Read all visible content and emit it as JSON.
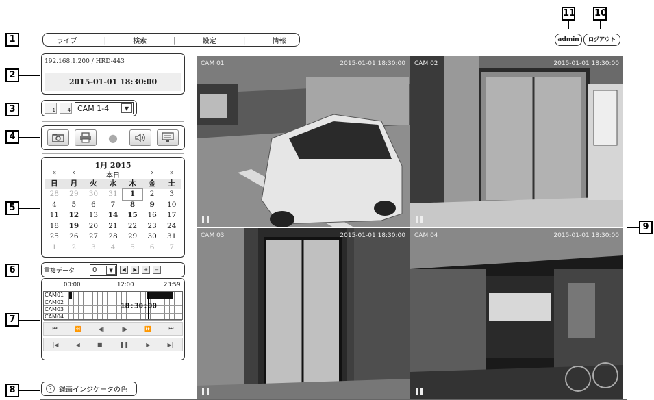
{
  "menu": {
    "items": [
      "ライブ",
      "検索",
      "設定",
      "情報"
    ]
  },
  "header": {
    "user": "admin",
    "logout": "ログアウト"
  },
  "device": {
    "address": "192.168.1.200 / HRD-443",
    "datetime": "2015-01-01 18:30:00"
  },
  "layout_bar": {
    "btn1": "1",
    "btn4": "4",
    "camera_select": "CAM 1-4"
  },
  "toolbar": {
    "icons": [
      "camera-icon",
      "printer-icon",
      "record-dot-icon",
      "speaker-icon",
      "monitor-icon"
    ]
  },
  "calendar": {
    "title": "1月 2015",
    "nav_prev_year": "«",
    "nav_prev_month": "‹",
    "today": "本日",
    "nav_next_month": "›",
    "nav_next_year": "»",
    "weekdays": [
      "日",
      "月",
      "火",
      "水",
      "木",
      "金",
      "土"
    ],
    "weeks": [
      [
        "28",
        "29",
        "30",
        "31",
        "1",
        "2",
        "3"
      ],
      [
        "4",
        "5",
        "6",
        "7",
        "8",
        "9",
        "10"
      ],
      [
        "11",
        "12",
        "13",
        "14",
        "15",
        "16",
        "17"
      ],
      [
        "18",
        "19",
        "20",
        "21",
        "22",
        "23",
        "24"
      ],
      [
        "25",
        "26",
        "27",
        "28",
        "29",
        "30",
        "31"
      ],
      [
        "1",
        "2",
        "3",
        "4",
        "5",
        "6",
        "7"
      ]
    ]
  },
  "duplicate": {
    "label": "重複データ",
    "value": "0",
    "prev": "◀",
    "next": "▶",
    "plus": "+",
    "minus": "−"
  },
  "timeline": {
    "hours": [
      "00:00",
      "12:00",
      "23:59"
    ],
    "cameras": [
      "CAM01",
      "CAM02",
      "CAM03",
      "CAM04"
    ],
    "current_time": "18:30:00",
    "controls_row1": [
      "⏮",
      "⏪",
      "◀|",
      "|▶",
      "⏩",
      "⏭"
    ],
    "controls_row2": [
      "|◀",
      "◀",
      "■",
      "❚❚",
      "▶",
      "▶|"
    ]
  },
  "legend": {
    "label": "録画インジケータの色",
    "icon": "?"
  },
  "cameras": [
    {
      "name": "CAM 01",
      "timestamp": "2015-01-01 18:30:00"
    },
    {
      "name": "CAM 02",
      "timestamp": "2015-01-01 18:30:00"
    },
    {
      "name": "CAM 03",
      "timestamp": "2015-01-01 18:30:00"
    },
    {
      "name": "CAM 04",
      "timestamp": "2015-01-01 18:30:00"
    }
  ],
  "callouts": [
    "1",
    "2",
    "3",
    "4",
    "5",
    "6",
    "7",
    "8",
    "9",
    "10",
    "11"
  ]
}
